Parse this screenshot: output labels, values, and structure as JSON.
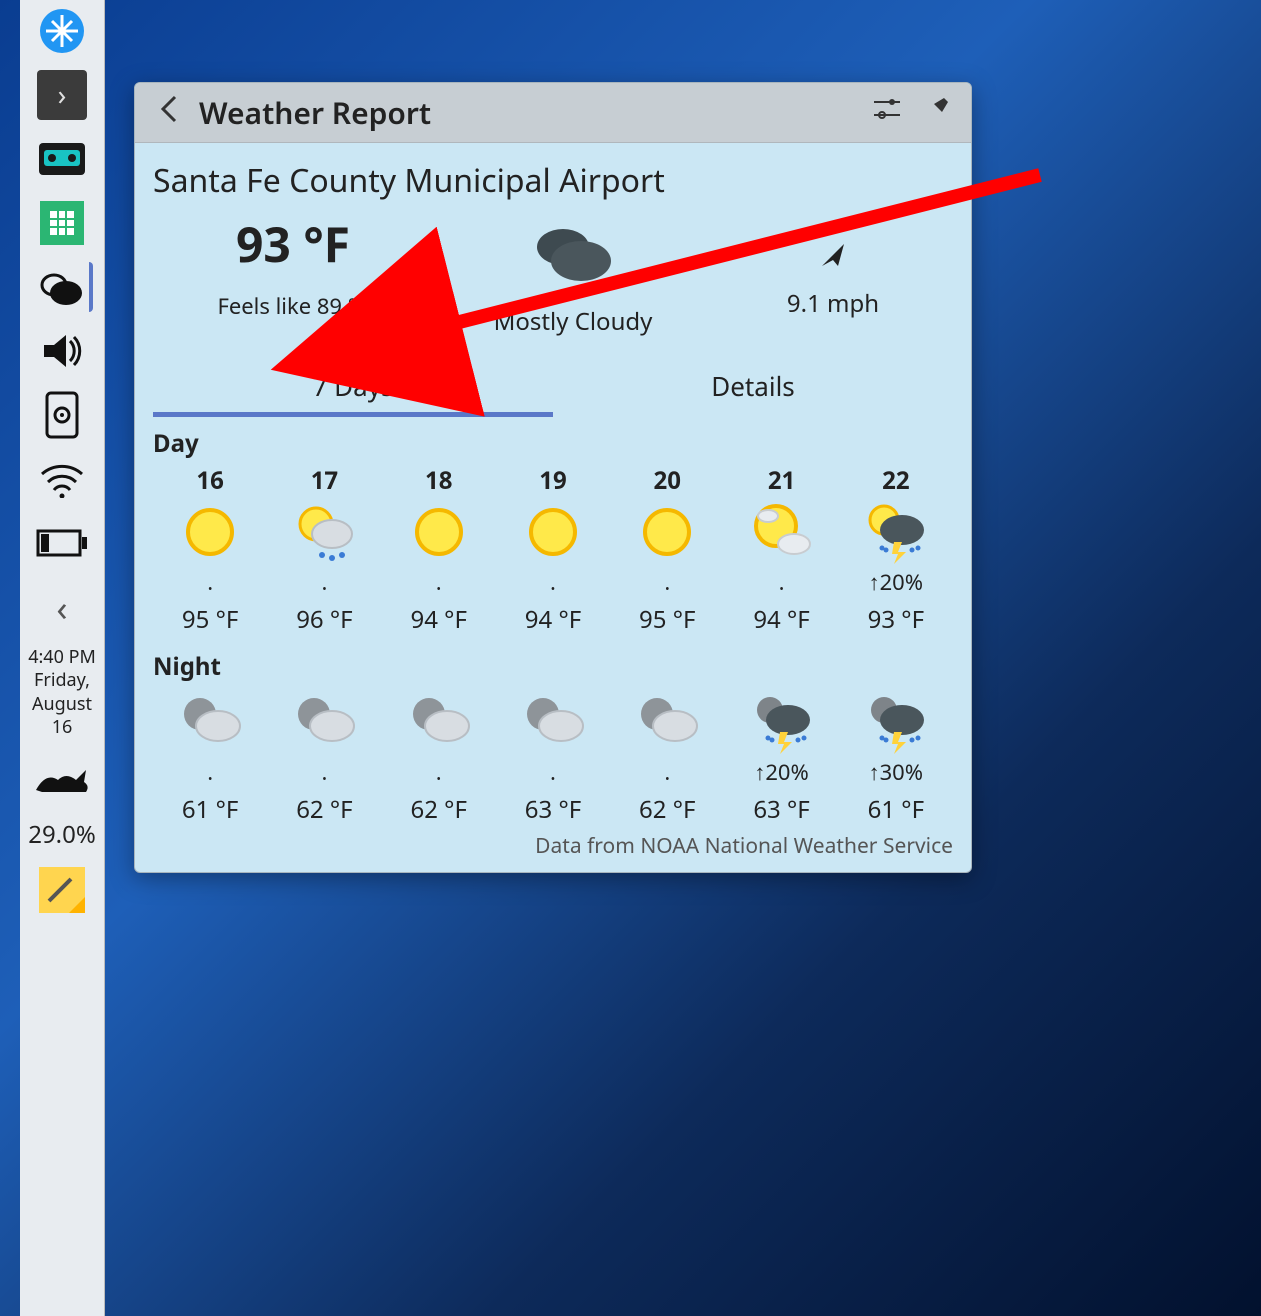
{
  "panel": {
    "clock_time": "4:40 PM",
    "clock_day": "Friday,",
    "clock_month": "August",
    "clock_date": "16",
    "cpu_pct": "29.0%"
  },
  "popup": {
    "title": "Weather Report",
    "location": "Santa Fe County Municipal Airport",
    "current": {
      "temp": "93 °F",
      "feels": "Feels like 89 °F",
      "condition": "Mostly Cloudy",
      "wind": "9.1 mph"
    },
    "tabs": {
      "days": "7 Days",
      "details": "Details"
    },
    "labels": {
      "day": "Day",
      "night": "Night"
    },
    "forecast": [
      {
        "date": "16",
        "day_icon": "sun",
        "day_precip": ".",
        "day_temp": "95 °F",
        "night_icon": "mooncloud",
        "night_precip": ".",
        "night_temp": "61 °F"
      },
      {
        "date": "17",
        "day_icon": "suncloudrain",
        "day_precip": ".",
        "day_temp": "96 °F",
        "night_icon": "mooncloud",
        "night_precip": ".",
        "night_temp": "62 °F"
      },
      {
        "date": "18",
        "day_icon": "sun",
        "day_precip": ".",
        "day_temp": "94 °F",
        "night_icon": "mooncloud",
        "night_precip": ".",
        "night_temp": "62 °F"
      },
      {
        "date": "19",
        "day_icon": "sun",
        "day_precip": ".",
        "day_temp": "94 °F",
        "night_icon": "mooncloud",
        "night_precip": ".",
        "night_temp": "63 °F"
      },
      {
        "date": "20",
        "day_icon": "sun",
        "day_precip": ".",
        "day_temp": "95 °F",
        "night_icon": "mooncloud",
        "night_precip": ".",
        "night_temp": "62 °F"
      },
      {
        "date": "21",
        "day_icon": "sunfewcloud",
        "day_precip": ".",
        "day_temp": "94 °F",
        "night_icon": "moonstorm",
        "night_precip": "↑20%",
        "night_temp": "63 °F"
      },
      {
        "date": "22",
        "day_icon": "sunstorm",
        "day_precip": "↑20%",
        "day_temp": "93 °F",
        "night_icon": "moonstorm",
        "night_precip": "↑30%",
        "night_temp": "61 °F"
      }
    ],
    "attribution": "Data from NOAA National Weather Service"
  }
}
